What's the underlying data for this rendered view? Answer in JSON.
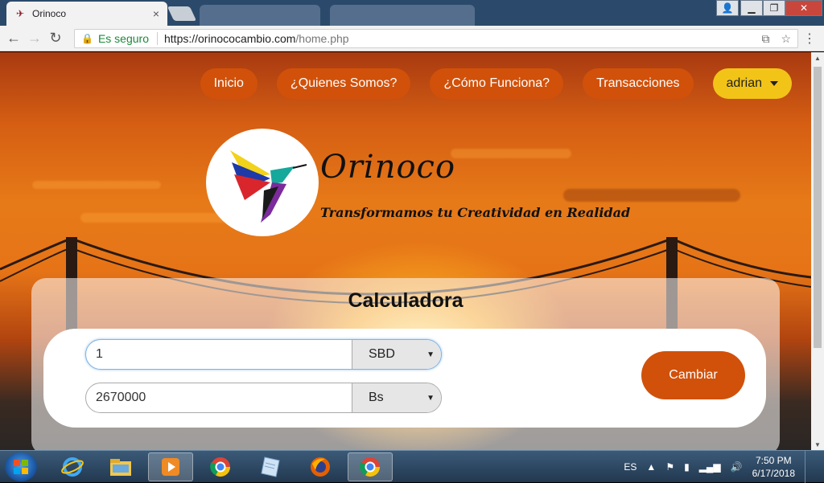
{
  "browser": {
    "tab_title": "Orinoco",
    "tab_close": "×",
    "secure_label": "Es seguro",
    "url_base": "https://orinococambio.com",
    "url_path": "/home.php",
    "window_controls": [
      "▁",
      "❐",
      "✕"
    ]
  },
  "nav": {
    "items": [
      "Inicio",
      "¿Quienes Somos?",
      "¿Cómo Funciona?",
      "Transacciones"
    ],
    "user": "adrian"
  },
  "brand": {
    "name": "Orinoco",
    "tagline": "Transformamos tu Creatividad en Realidad"
  },
  "calculator": {
    "title": "Calculadora",
    "amount_value": "1",
    "amount_currency": "SBD",
    "result_value": "2670000",
    "result_currency": "Bs",
    "submit_label": "Cambiar"
  },
  "taskbar": {
    "language": "ES",
    "time": "7:50 PM",
    "date": "6/17/2018"
  },
  "colors": {
    "accent_orange": "#d1510a",
    "user_yellow": "#f2c418"
  }
}
